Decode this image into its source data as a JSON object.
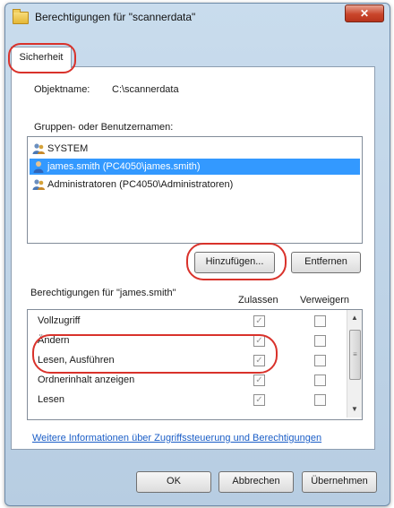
{
  "window": {
    "title": "Berechtigungen für \"scannerdata\"",
    "close_glyph": "✕"
  },
  "tabs": [
    {
      "label": "Sicherheit",
      "selected": true
    }
  ],
  "object": {
    "label": "Objektname:",
    "value": "C:\\scannerdata"
  },
  "groups": {
    "label": "Gruppen- oder Benutzernamen:",
    "items": [
      {
        "name": "SYSTEM",
        "icon": "group-icon",
        "selected": false
      },
      {
        "name": "james.smith (PC4050\\james.smith)",
        "icon": "user-icon",
        "selected": true
      },
      {
        "name": "Administratoren (PC4050\\Administratoren)",
        "icon": "group-icon",
        "selected": false
      }
    ]
  },
  "buttons": {
    "add": "Hinzufügen...",
    "remove": "Entfernen",
    "ok": "OK",
    "cancel": "Abbrechen",
    "apply": "Übernehmen"
  },
  "permissions": {
    "label": "Berechtigungen für \"james.smith\"",
    "col_allow": "Zulassen",
    "col_deny": "Verweigern",
    "rows": [
      {
        "name": "Vollzugriff",
        "allow": true,
        "deny": false
      },
      {
        "name": "Ändern",
        "allow": true,
        "deny": false
      },
      {
        "name": "Lesen, Ausführen",
        "allow": true,
        "deny": false
      },
      {
        "name": "Ordnerinhalt anzeigen",
        "allow": true,
        "deny": false
      },
      {
        "name": "Lesen",
        "allow": true,
        "deny": false
      }
    ]
  },
  "link": "Weitere Informationen über Zugriffssteuerung und Berechtigungen",
  "colors": {
    "highlight": "#d9322b",
    "selection": "#3399ff",
    "link": "#1b5ec7"
  }
}
